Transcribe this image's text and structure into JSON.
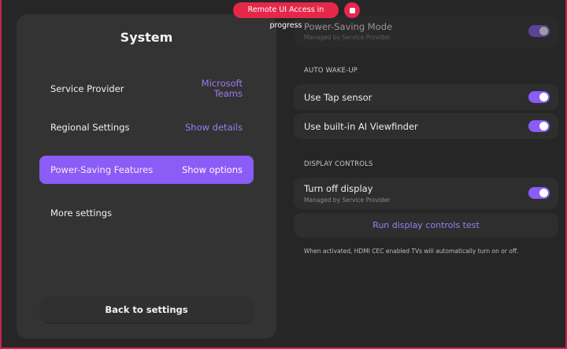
{
  "banner": {
    "text": "Remote UI Access in progress"
  },
  "system_panel": {
    "title": "System",
    "items": [
      {
        "label": "Service Provider",
        "value_line1": "Microsoft",
        "value_line2": "Teams"
      },
      {
        "label": "Regional Settings",
        "value": "Show details"
      },
      {
        "label": "Power-Saving Features",
        "value": "Show options",
        "active": true
      },
      {
        "label": "More settings"
      }
    ],
    "back_label": "Back to settings"
  },
  "right_panel": {
    "power_saving": {
      "label": "Power-Saving Mode",
      "sub": "Managed by Service Provider.",
      "enabled": true,
      "locked": true
    },
    "auto_wakeup": {
      "header": "AUTO WAKE-UP",
      "items": [
        {
          "label": "Use Tap sensor",
          "enabled": true
        },
        {
          "label": "Use built-in AI Viewfinder",
          "enabled": true
        }
      ]
    },
    "display_controls": {
      "header": "DISPLAY CONTROLS",
      "turn_off": {
        "label": "Turn off display",
        "sub": "Managed by Service Provider",
        "enabled": true
      },
      "test_button": "Run display controls test",
      "footnote": "When activated, HDMI CEC enabled TVs will automatically turn on or off."
    }
  },
  "colors": {
    "accent": "#8b5cf6",
    "banner": "#e5284a",
    "background": "#262626"
  }
}
